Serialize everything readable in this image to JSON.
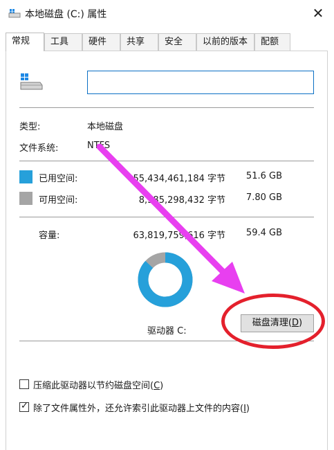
{
  "window": {
    "title": "本地磁盘 (C:) 属性",
    "close_glyph": "✕"
  },
  "tabs": [
    {
      "label": "常规",
      "active": true
    },
    {
      "label": "工具"
    },
    {
      "label": "硬件"
    },
    {
      "label": "共享"
    },
    {
      "label": "安全"
    },
    {
      "label": "以前的版本"
    },
    {
      "label": "配额"
    }
  ],
  "general": {
    "drive_name_value": "",
    "type_label": "类型:",
    "type_value": "本地磁盘",
    "fs_label": "文件系统:",
    "fs_value": "NTFS",
    "used": {
      "label": "已用空间:",
      "bytes": "55,434,461,184 字节",
      "size": "51.6 GB",
      "color": "#26a0da"
    },
    "free": {
      "label": "可用空间:",
      "bytes": "8,385,298,432 字节",
      "size": "7.80 GB",
      "color": "#a5a5a5"
    },
    "capacity": {
      "label": "容量:",
      "bytes": "63,819,759,616 字节",
      "size": "59.4 GB"
    },
    "drive_label": "驱动器 C:",
    "cleanup_button": {
      "text": "磁盘清理(",
      "hotkey": "D",
      "close": ")"
    },
    "used_fraction": 0.869
  },
  "options": {
    "compress": {
      "text": "压缩此驱动器以节约磁盘空间(",
      "hotkey": "C",
      "close": ")",
      "checked": false
    },
    "index": {
      "text": "除了文件属性外，还允许索引此驱动器上文件的内容(",
      "hotkey": "I",
      "close": ")",
      "checked": true
    }
  },
  "annotation": {
    "arrow_color": "#e83ff0",
    "ellipse_color": "#e4202c"
  }
}
